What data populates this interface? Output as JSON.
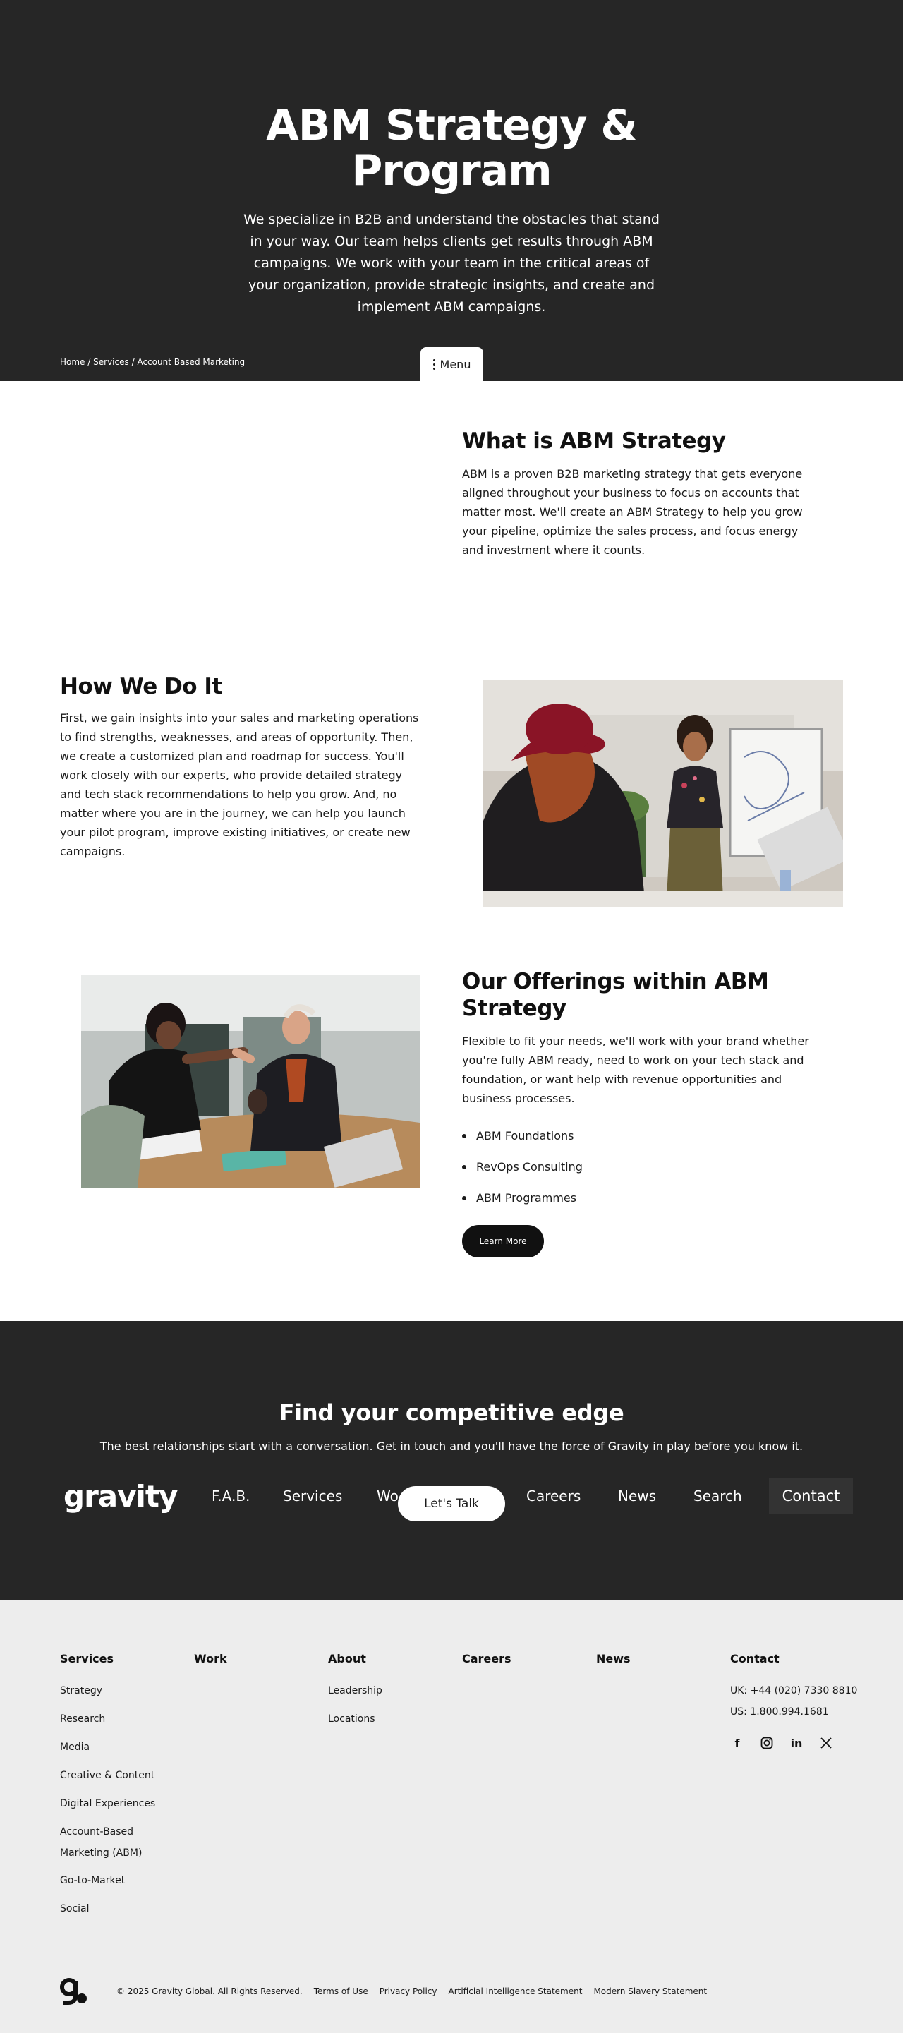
{
  "hero": {
    "title": "ABM Strategy & Program",
    "description": "We specialize in B2B and understand the obstacles that stand in your way. Our team helps clients get results through ABM campaigns. We work with your team in the critical areas of your organization, provide strategic insights, and create and implement ABM campaigns."
  },
  "breadcrumb": {
    "home": "Home",
    "services": "Services",
    "current": "Account Based Marketing",
    "separator": "/"
  },
  "menu": {
    "label": "Menu"
  },
  "what": {
    "title": "What is ABM Strategy",
    "text": "ABM is a proven B2B marketing strategy that gets everyone aligned throughout your business to focus on accounts that matter most. We'll create an ABM Strategy to help you grow your pipeline, optimize the sales process, and focus energy and investment where it counts."
  },
  "how": {
    "title": "How We Do It",
    "text": "First, we gain insights into your sales and marketing operations to find strengths, weaknesses, and areas of opportunity. Then, we create a customized plan and roadmap for success. You'll work closely with our experts, who provide detailed strategy and tech stack recommendations to help you grow. And, no matter where you are in the journey, we can help you launch your pilot program, improve existing initiatives, or create new campaigns."
  },
  "offerings": {
    "title": "Our Offerings within ABM Strategy",
    "text": "Flexible to fit your needs, we'll work with your brand whether you're fully ABM ready, need to work on your tech stack and foundation, or want help with revenue opportunities and business processes.",
    "items": [
      "ABM Foundations",
      "RevOps Consulting",
      "ABM Programmes"
    ],
    "button": "Learn More"
  },
  "cta": {
    "title": "Find your competitive edge",
    "text": "The best relationships start with a conversation. Get in touch and you'll have the force of Gravity in play before you know it.",
    "button": "Let's Talk"
  },
  "nav": {
    "logo": "gravity",
    "items": [
      "F.A.B.",
      "Services",
      "Wo",
      "Careers",
      "News",
      "Search"
    ],
    "contact": "Contact"
  },
  "footer": {
    "columns": {
      "services": {
        "heading": "Services",
        "links": [
          "Strategy",
          "Research",
          "Media",
          "Creative & Content",
          "Digital Experiences",
          "Account-Based Marketing (ABM)",
          "Go-to-Market",
          "Social"
        ]
      },
      "work": {
        "heading": "Work"
      },
      "about": {
        "heading": "About",
        "links": [
          "Leadership",
          "Locations"
        ]
      },
      "careers": {
        "heading": "Careers"
      },
      "news": {
        "heading": "News"
      },
      "contact": {
        "heading": "Contact",
        "uk": "UK: +44 (020) 7330 8810",
        "us": "US: 1.800.994.1681"
      }
    },
    "social_icons": [
      "facebook-icon",
      "instagram-icon",
      "linkedin-icon",
      "x-icon"
    ],
    "social_labels": {
      "facebook": "f",
      "linkedin": "in"
    },
    "copyright": "© 2025 Gravity Global. All Rights Reserved.",
    "links": [
      "Terms of Use",
      "Privacy Policy",
      "Artificial Intelligence Statement",
      "Modern Slavery Statement"
    ]
  },
  "colors": {
    "dark": "#262626",
    "footer_bg": "#ededed",
    "accent_red": "#9b1d2a"
  }
}
